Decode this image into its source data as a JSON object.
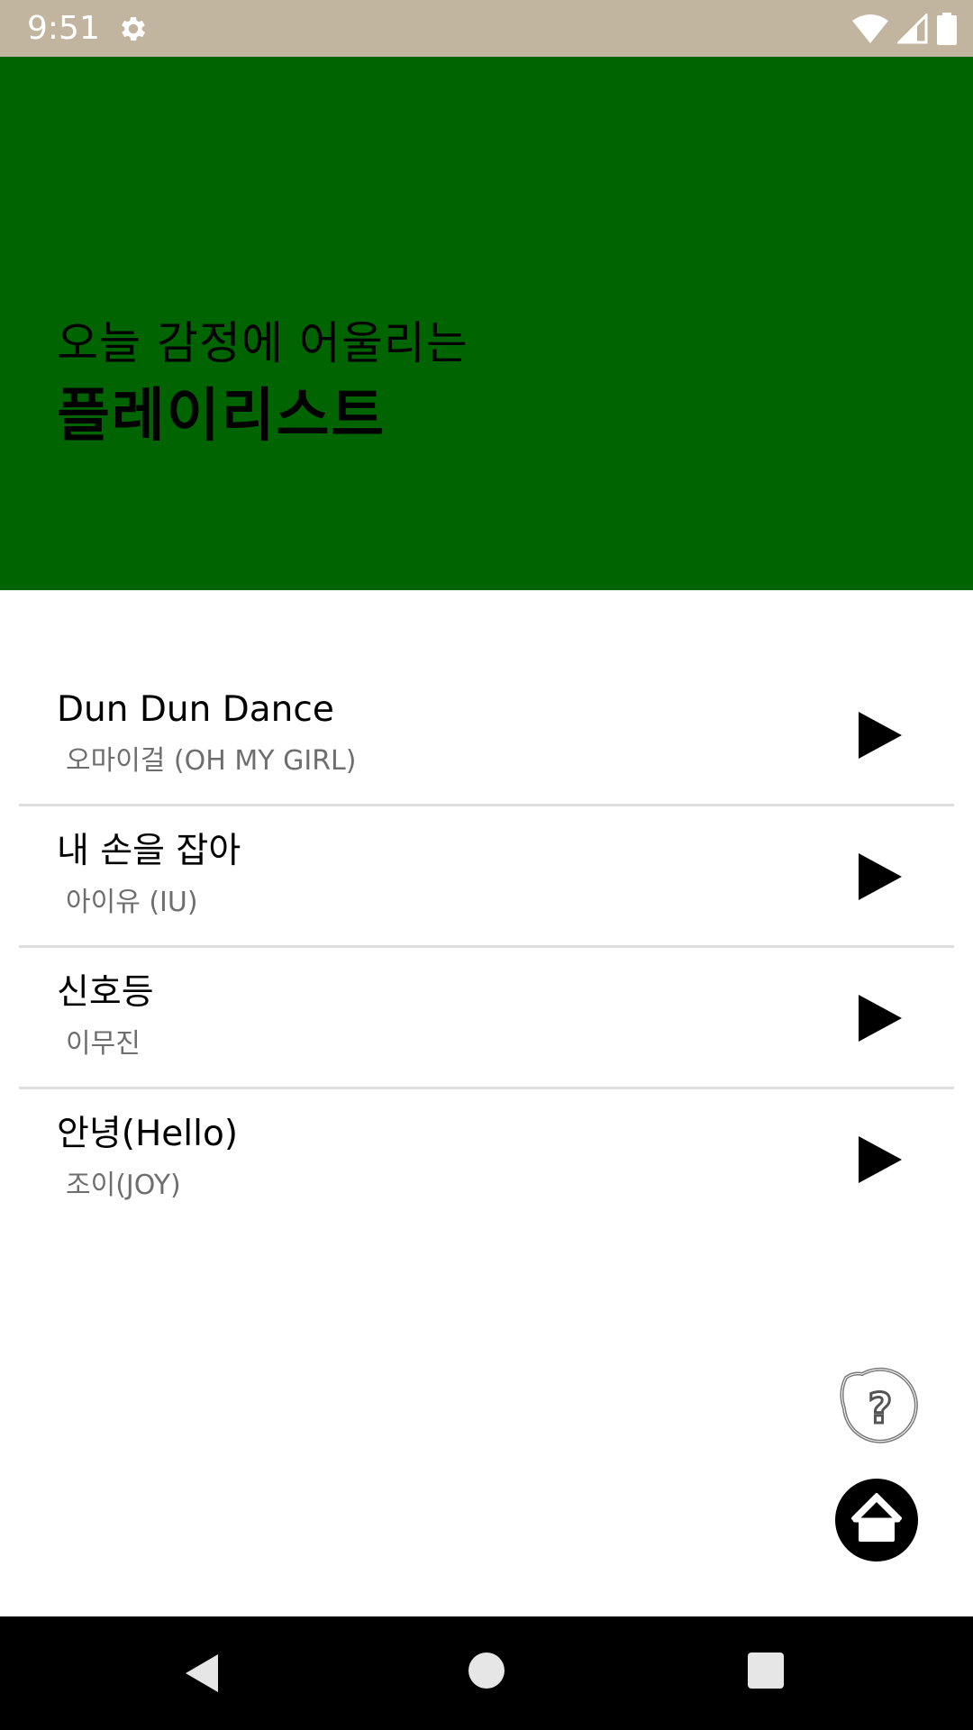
{
  "status_bar": {
    "time": "9:51",
    "icons": [
      "gear-icon",
      "wifi-icon",
      "signal-icon",
      "battery-icon"
    ]
  },
  "header": {
    "subtitle": "오늘 감정에 어울리는",
    "title": "플레이리스트",
    "background_color": "#006400"
  },
  "songs": [
    {
      "title": "Dun Dun Dance",
      "artist": "오마이걸 (OH MY GIRL)"
    },
    {
      "title": "내 손을 잡아",
      "artist": "아이유 (IU)"
    },
    {
      "title": "신호등",
      "artist": "이무진"
    },
    {
      "title": "안녕(Hello)",
      "artist": "조이(JOY)"
    }
  ],
  "floating_buttons": {
    "help_icon": "question-bubble-icon",
    "home_icon": "home-icon"
  },
  "nav_bar": {
    "icons": [
      "back-icon",
      "home-circle-icon",
      "recent-apps-icon"
    ]
  }
}
